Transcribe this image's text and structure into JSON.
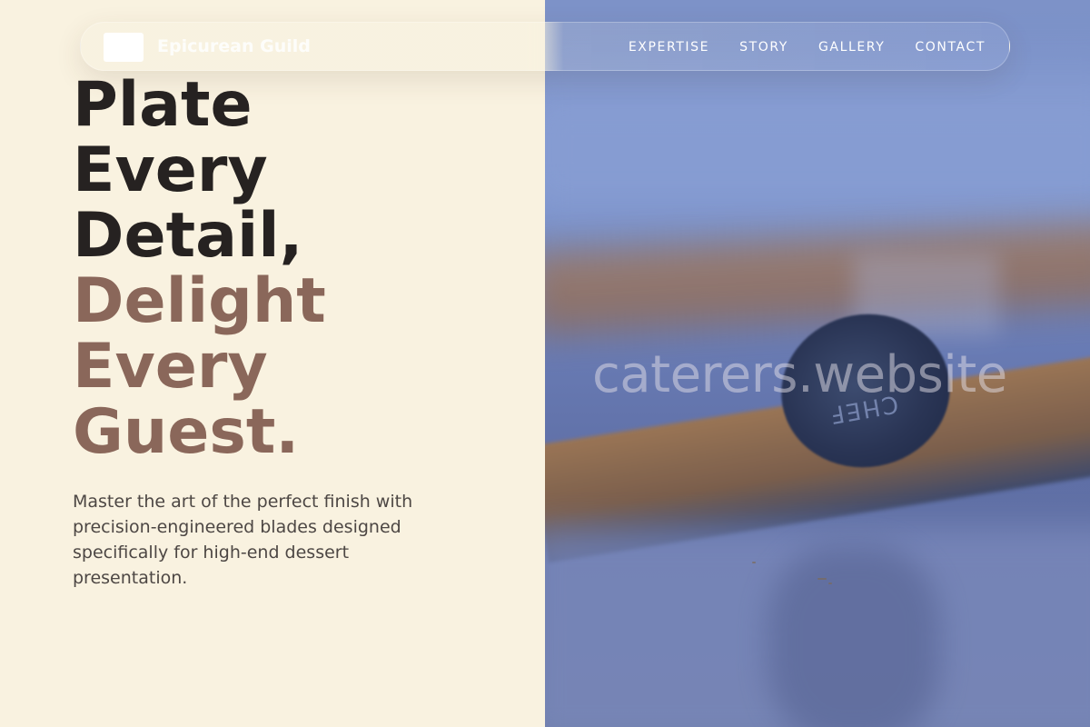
{
  "nav": {
    "brand": "Epicurean Guild",
    "links": [
      "EXPERTISE",
      "STORY",
      "GALLERY",
      "CONTACT"
    ]
  },
  "hero": {
    "headline_dark": [
      "Plate",
      "Every",
      "Detail,"
    ],
    "headline_accent": [
      "Delight",
      "Every",
      "Guest."
    ],
    "subtext": "Master the art of the perfect finish with precision-engineered blades designed specifically for high-end dessert presentation."
  },
  "image": {
    "stamp_text": "CHEF",
    "watermark": "caterers.website"
  },
  "colors": {
    "background": "#f9f2e0",
    "headline_dark": "#262221",
    "headline_accent": "#8a675a",
    "body_text": "#4d4744",
    "photo_tint": "#7b8ec6"
  }
}
